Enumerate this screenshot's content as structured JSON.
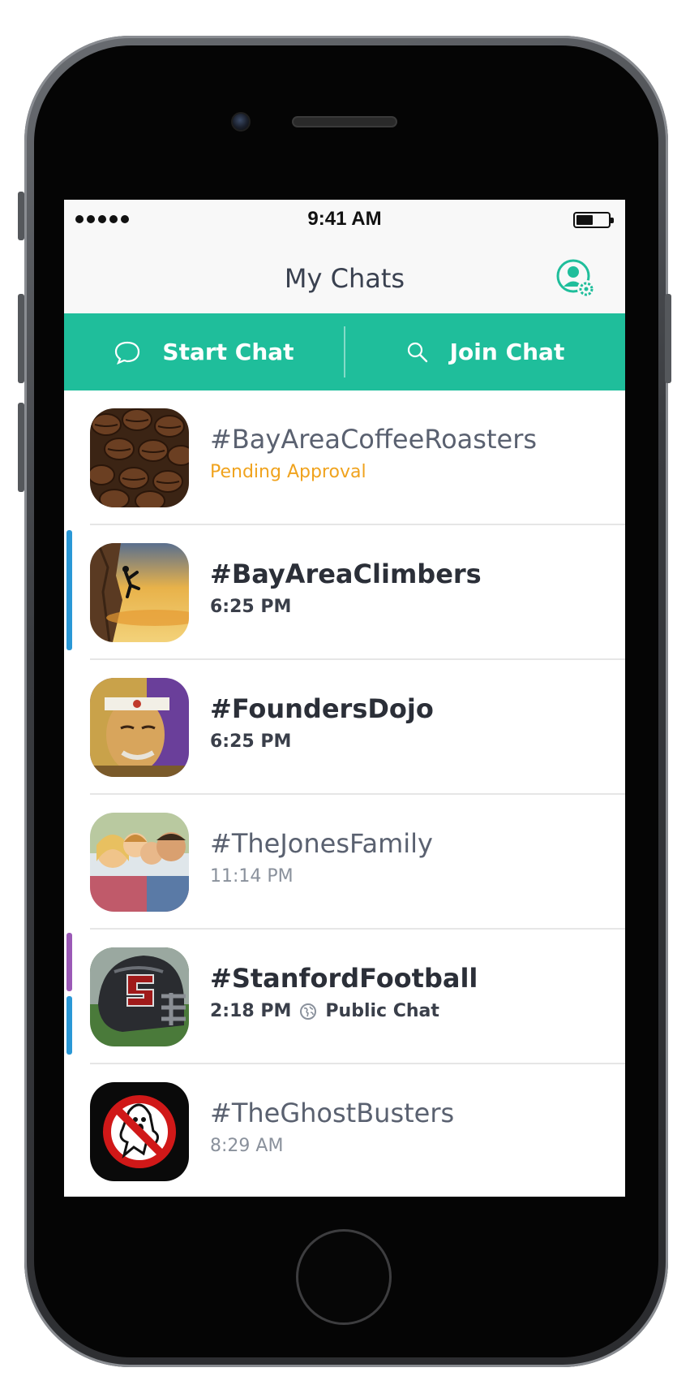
{
  "status_bar": {
    "time": "9:41 AM"
  },
  "nav": {
    "title": "My Chats"
  },
  "actions": {
    "start_label": "Start Chat",
    "join_label": "Join Chat"
  },
  "colors": {
    "accent": "#1fbe9b",
    "pending": "#f0a31e",
    "indicator_blue": "#2a98d6",
    "indicator_purple": "#9b59b6"
  },
  "chats": [
    {
      "name": "#BayAreaCoffeeRoasters",
      "subtitle": "Pending Approval",
      "avatar": "coffee-beans-avatar"
    },
    {
      "name": "#BayAreaClimbers",
      "subtitle": "6:25 PM",
      "avatar": "climber-sunset-avatar"
    },
    {
      "name": "#FoundersDojo",
      "subtitle": "6:25 PM",
      "avatar": "karate-master-avatar"
    },
    {
      "name": "#TheJonesFamily",
      "subtitle": "11:14 PM",
      "avatar": "family-photo-avatar"
    },
    {
      "name": "#StanfordFootball",
      "subtitle": "2:18 PM",
      "extra": "Public Chat",
      "avatar": "football-helmet-avatar"
    },
    {
      "name": "#TheGhostBusters",
      "subtitle": "8:29 AM",
      "avatar": "ghostbusters-logo-avatar"
    }
  ]
}
